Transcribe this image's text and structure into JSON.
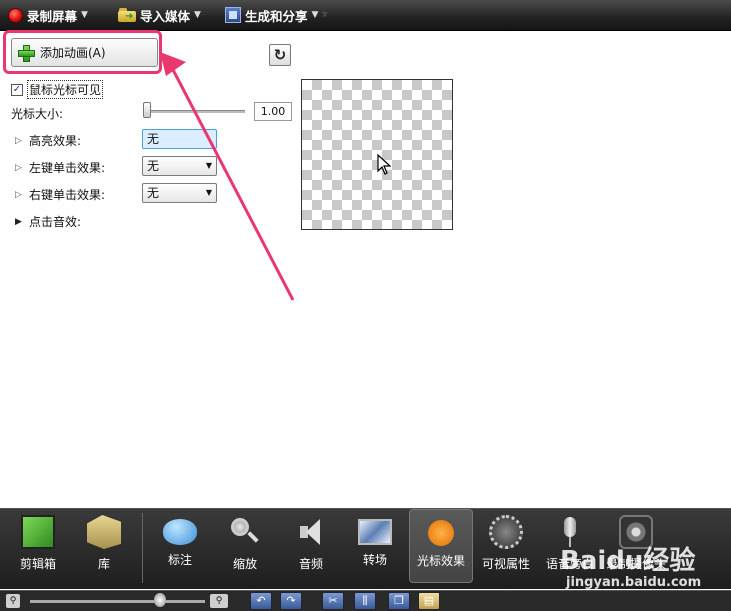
{
  "toolbar": {
    "record_label": "录制屏幕",
    "import_label": "导入媒体",
    "produce_label": "生成和分享"
  },
  "properties": {
    "add_animation_label": "添加动画(A)",
    "cursor_visible_label": "鼠标光标可见",
    "cursor_size_label": "光标大小:",
    "cursor_size_value": "1.00",
    "highlight_label": "高亮效果:",
    "highlight_value": "无",
    "left_click_label": "左键单击效果:",
    "left_click_value": "无",
    "right_click_label": "右键单击效果:",
    "right_click_value": "无",
    "click_sound_label": "点击音效:"
  },
  "tabs": [
    {
      "label": "剪辑箱",
      "icon": "clip-bin-icon"
    },
    {
      "label": "库",
      "icon": "library-icon"
    },
    {
      "label": "标注",
      "icon": "callout-icon"
    },
    {
      "label": "缩放",
      "icon": "zoom-icon"
    },
    {
      "label": "音频",
      "icon": "audio-icon"
    },
    {
      "label": "转场",
      "icon": "transition-icon"
    },
    {
      "label": "光标效果",
      "icon": "cursor-effect-icon",
      "selected": true
    },
    {
      "label": "可视属性",
      "icon": "visual-properties-icon"
    },
    {
      "label": "语音旁白",
      "icon": "microphone-icon"
    },
    {
      "label": "录制摄像头",
      "icon": "camera-icon"
    }
  ],
  "watermark": {
    "logo": "Baidu经验",
    "url": "jingyan.baidu.com"
  },
  "colors": {
    "annotation": "#e8386f",
    "selected_tab": "#555555"
  }
}
